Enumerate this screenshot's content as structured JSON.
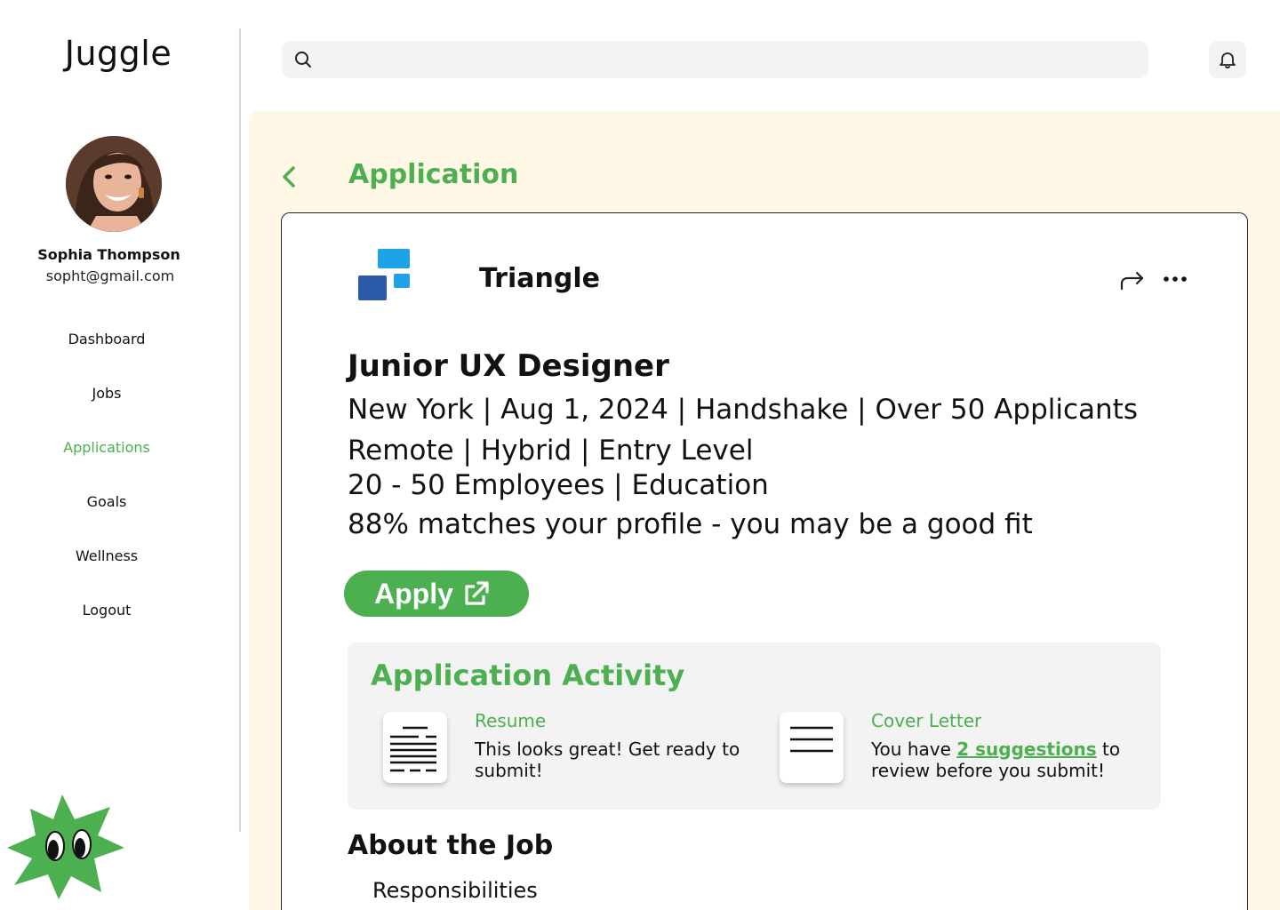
{
  "app": {
    "logo_text": "Juggle"
  },
  "profile": {
    "name": "Sophia Thompson",
    "email": "sopht@gmail.com"
  },
  "nav": {
    "items": [
      {
        "label": "Dashboard",
        "active": false
      },
      {
        "label": "Jobs",
        "active": false
      },
      {
        "label": "Applications",
        "active": true
      },
      {
        "label": "Goals",
        "active": false
      },
      {
        "label": "Wellness",
        "active": false
      },
      {
        "label": "Logout",
        "active": false
      }
    ]
  },
  "search": {
    "value": "",
    "icon": "search-icon"
  },
  "header": {
    "notification_icon": "bell-icon"
  },
  "page": {
    "title": "Application",
    "back_icon": "chevron-left-icon"
  },
  "job": {
    "company": "Triangle",
    "title": "Junior UX Designer",
    "line1": "New York | Aug 1, 2024 | Handshake | Over 50 Applicants",
    "line2": "Remote | Hybrid | Entry Level",
    "line3": "20 - 50 Employees | Education",
    "line4": "88% matches your profile - you may be a good fit",
    "apply_label": "Apply"
  },
  "activity": {
    "title": "Application Activity",
    "resume": {
      "heading": "Resume",
      "text": "This looks great! Get ready to submit!"
    },
    "cover_letter": {
      "heading": "Cover Letter",
      "text_before": "You have ",
      "link": "2 suggestions",
      "text_after": " to review before you submit!"
    }
  },
  "about": {
    "title": "About the Job",
    "subtitle": "Responsibilities"
  },
  "colors": {
    "accent": "#4caf50",
    "panel_bg": "#fff8e6",
    "muted_bg": "#f3f3f3",
    "logo_dark_blue": "#2b5aa8",
    "logo_light_blue": "#1fa3e8"
  }
}
